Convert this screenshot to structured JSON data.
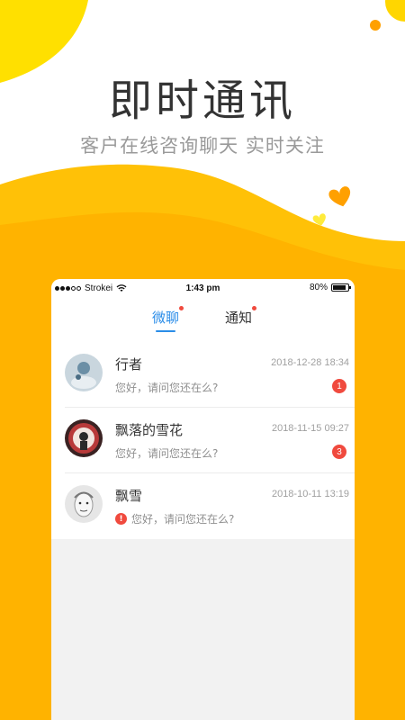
{
  "promo": {
    "headline": "即时通讯",
    "subline": "客户在线咨询聊天  实时关注"
  },
  "colors": {
    "accent_yellow": "#FFC107",
    "accent_orange": "#FFA000",
    "tab_active": "#2B8DE8",
    "badge_red": "#F04A3E"
  },
  "statusbar": {
    "carrier": "Strokei",
    "time": "1:43 pm",
    "battery": "80%"
  },
  "tabs": [
    {
      "label": "微聊",
      "active": true
    },
    {
      "label": "通知",
      "active": false
    }
  ],
  "chats": [
    {
      "name": "行者",
      "time": "2018-12-28 18:34",
      "message": "您好，请问您还在么?",
      "badge": "1",
      "avatar": "avatar-1"
    },
    {
      "name": "飘落的雪花",
      "time": "2018-11-15 09:27",
      "message": "您好，请问您还在么?",
      "badge": "3",
      "avatar": "avatar-2"
    },
    {
      "name": "飘雪",
      "time": "2018-10-11 13:19",
      "message": "您好，请问您还在么?",
      "error": "!",
      "avatar": "avatar-3"
    }
  ]
}
